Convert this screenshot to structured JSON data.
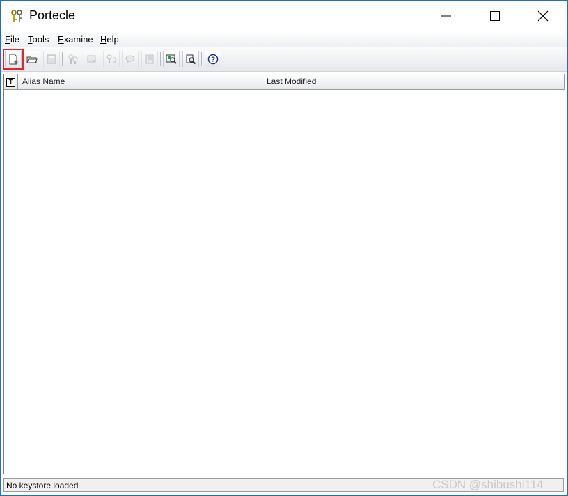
{
  "window": {
    "title": "Portecle"
  },
  "menu": {
    "file": "File",
    "tools": "Tools",
    "examine": "Examine",
    "help": "Help"
  },
  "toolbar": {
    "buttons": [
      {
        "icon": "new-keystore-icon",
        "enabled": true,
        "highlighted": true
      },
      {
        "icon": "open-keystore-icon",
        "enabled": true
      },
      {
        "icon": "save-keystore-icon",
        "enabled": false
      },
      {
        "icon": "generate-keypair-icon",
        "enabled": false
      },
      {
        "icon": "import-cert-icon",
        "enabled": false
      },
      {
        "icon": "import-keypair-icon",
        "enabled": false
      },
      {
        "icon": "set-password-icon",
        "enabled": false
      },
      {
        "icon": "report-icon",
        "enabled": false
      },
      {
        "icon": "examine-cert-icon",
        "enabled": true
      },
      {
        "icon": "examine-crl-icon",
        "enabled": true
      },
      {
        "icon": "help-icon",
        "enabled": true
      }
    ]
  },
  "table": {
    "columns": {
      "type": "T",
      "alias": "Alias Name",
      "modified": "Last Modified"
    }
  },
  "status": {
    "text": "No keystore loaded"
  },
  "watermark": "CSDN @shibushi114",
  "colors": {
    "highlight": "#e8242b",
    "border": "#1f6fc5"
  }
}
